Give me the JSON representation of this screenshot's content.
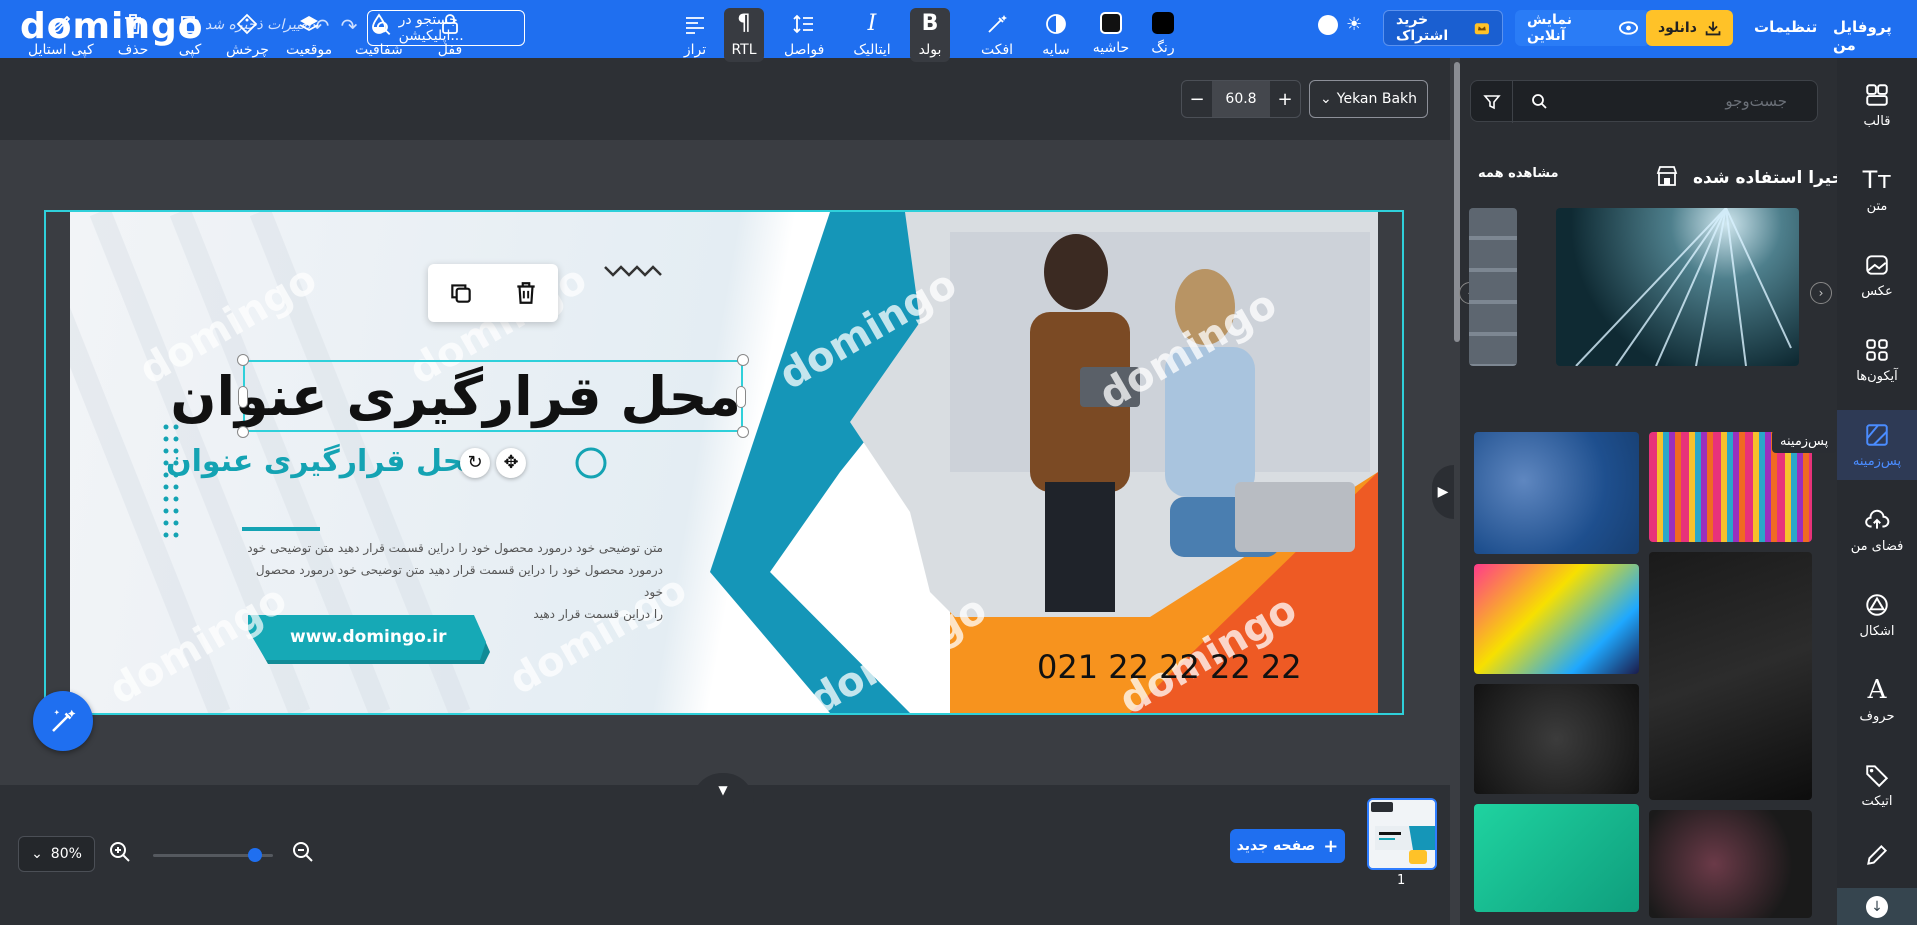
{
  "app": {
    "logo": "domingo",
    "saved_status": "تغییرات ذخیره شد",
    "search_label": "جستجو در اپلیکیشن...",
    "subscribe_label": "خرید اشتراک",
    "live_label": "نمایش آنلاین",
    "download_label": "دانلود",
    "settings_label": "تنظیمات",
    "profile_label": "پروفایل من",
    "accent": "#1f6ff0",
    "download_color": "#ffc228"
  },
  "toolbar": {
    "font_name": "Yekan Bakh",
    "font_size": "60.8",
    "tools": {
      "color": "رنگ",
      "border": "حاشیه",
      "shadow": "سایه",
      "effect": "افکت",
      "bold": "بولد",
      "italic": "ایتالیک",
      "spacing": "فواصل",
      "rtl": "RTL",
      "align": "تراز",
      "lock": "قفل",
      "opacity": "شفافیت",
      "position": "موقعیت",
      "rotate": "چرخش",
      "copy": "کپی",
      "delete": "حذف",
      "copy_style": "کپی استایل"
    }
  },
  "rail": {
    "items": [
      {
        "label": "قالب",
        "icon": "template-icon"
      },
      {
        "label": "متن",
        "icon": "text-icon"
      },
      {
        "label": "عکس",
        "icon": "image-icon"
      },
      {
        "label": "آیکون‌ها",
        "icon": "icons-icon"
      },
      {
        "label": "پس‌زمینه",
        "icon": "background-icon"
      },
      {
        "label": "فضای من",
        "icon": "upload-icon"
      },
      {
        "label": "اشکال",
        "icon": "shapes-icon"
      },
      {
        "label": "حروف",
        "icon": "letters-icon"
      },
      {
        "label": "اتیکت",
        "icon": "tag-icon"
      }
    ],
    "tooltip": "پس‌زمینه"
  },
  "panel": {
    "search_placeholder": "جست‌وجو",
    "recent_title": "اخیرا استفاده شده",
    "see_all": "مشاهده همه"
  },
  "design": {
    "title_big": "محل قرارگیری عنوان",
    "title_small": "محل قرارگیری عنوان",
    "body_line1": "متن توضیحی خود درمورد محصول خود را دراین قسمت قرار دهید  متن توضیحی خود",
    "body_line2": "درمورد محصول خود را دراین قسمت قرار دهید متن توضیحی خود درمورد محصول خود",
    "body_line3": "را دراین قسمت قرار دهید",
    "website": "www.domingo.ir",
    "phone": "021 22 22 22 22",
    "watermark": "domingo"
  },
  "bottom": {
    "zoom": "80%",
    "new_page": "صفحه جدید",
    "page_number": "1"
  }
}
